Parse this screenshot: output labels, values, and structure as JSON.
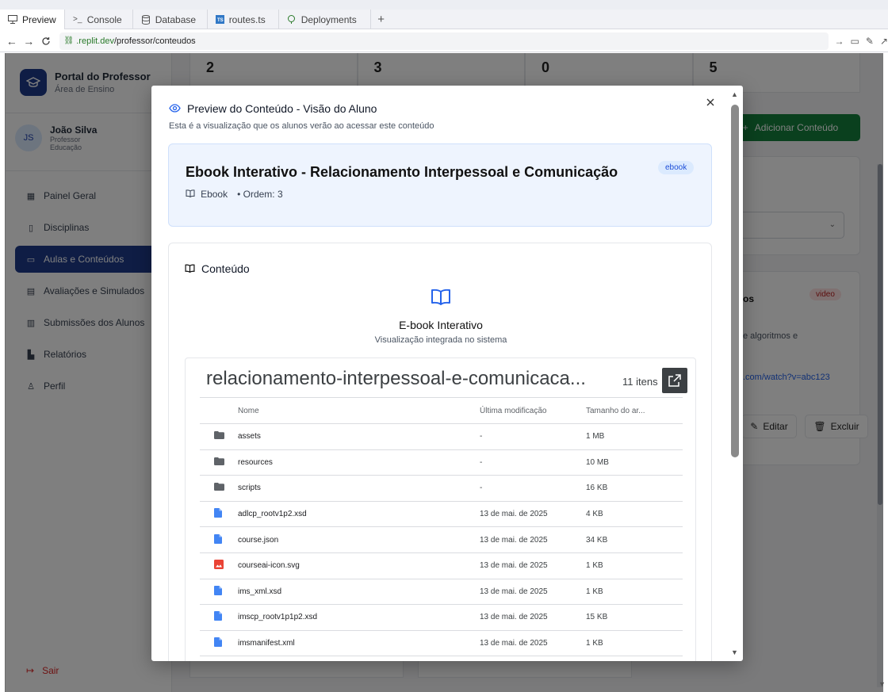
{
  "browser": {
    "tabs": [
      {
        "label": "Preview",
        "icon": "monitor-icon",
        "active": true
      },
      {
        "label": "Console",
        "icon": "terminal-icon",
        "active": false
      },
      {
        "label": "Database",
        "icon": "database-icon",
        "active": false
      },
      {
        "label": "routes.ts",
        "icon": "typescript-icon",
        "active": false
      },
      {
        "label": "Deployments",
        "icon": "deploy-icon",
        "active": false
      }
    ],
    "url_domain": ".replit.dev",
    "url_path": "/professor/conteudos"
  },
  "sidebar": {
    "brand_title": "Portal do Professor",
    "brand_subtitle": "Área de Ensino",
    "user_initials": "JS",
    "user_name": "João Silva",
    "user_role": "Professor",
    "user_dept": "Educação",
    "items": [
      {
        "label": "Painel Geral",
        "icon": "grid-icon"
      },
      {
        "label": "Disciplinas",
        "icon": "book-icon"
      },
      {
        "label": "Aulas e Conteúdos",
        "icon": "video-icon"
      },
      {
        "label": "Avaliações e Simulados",
        "icon": "file-text-icon"
      },
      {
        "label": "Submissões dos Alunos",
        "icon": "clipboard-icon"
      },
      {
        "label": "Relatórios",
        "icon": "bar-chart-icon"
      },
      {
        "label": "Perfil",
        "icon": "user-icon"
      }
    ],
    "active_index": 2,
    "logout_label": "Sair"
  },
  "background": {
    "stats": [
      "2",
      "3",
      "0",
      "5"
    ],
    "add_button": "Adicionar Conteúdo",
    "card_title_fragment": "os",
    "card_badge": "video",
    "card_text_fragment": "e algoritmos e",
    "card_link_fragment": ".com/watch?v=abc123",
    "edit_label": "Editar",
    "delete_label": "Excluir"
  },
  "modal": {
    "title": "Preview do Conteúdo - Visão do Aluno",
    "subtitle": "Esta é a visualização que os alunos verão ao acessar este conteúdo",
    "content_title": "Ebook Interativo - Relacionamento Interpessoal e Comunicação",
    "content_badge": "ebook",
    "content_type": "Ebook",
    "content_order": "• Ordem: 3",
    "section_title": "Conteúdo",
    "ebook_title": "E-book Interativo",
    "ebook_subtitle": "Visualização integrada no sistema",
    "viewer": {
      "folder_name": "relacionamento-interpessoal-e-comunicaca...",
      "item_count": "11 itens",
      "columns": [
        "Nome",
        "Última modificação",
        "Tamanho do ar..."
      ],
      "rows": [
        {
          "type": "folder",
          "name": "assets",
          "modified": "-",
          "size": "1 MB"
        },
        {
          "type": "folder",
          "name": "resources",
          "modified": "-",
          "size": "10 MB"
        },
        {
          "type": "folder",
          "name": "scripts",
          "modified": "-",
          "size": "16 KB"
        },
        {
          "type": "doc",
          "name": "adlcp_rootv1p2.xsd",
          "modified": "13 de mai. de 2025",
          "size": "4 KB"
        },
        {
          "type": "doc",
          "name": "course.json",
          "modified": "13 de mai. de 2025",
          "size": "34 KB"
        },
        {
          "type": "image",
          "name": "courseai-icon.svg",
          "modified": "13 de mai. de 2025",
          "size": "1 KB"
        },
        {
          "type": "doc",
          "name": "ims_xml.xsd",
          "modified": "13 de mai. de 2025",
          "size": "1 KB"
        },
        {
          "type": "doc",
          "name": "imscp_rootv1p1p2.xsd",
          "modified": "13 de mai. de 2025",
          "size": "15 KB"
        },
        {
          "type": "doc",
          "name": "imsmanifest.xml",
          "modified": "13 de mai. de 2025",
          "size": "1 KB"
        }
      ]
    }
  },
  "colors": {
    "primary": "#1e3a8a",
    "accent_blue": "#2563eb",
    "success": "#15803d",
    "danger": "#dc2626"
  }
}
